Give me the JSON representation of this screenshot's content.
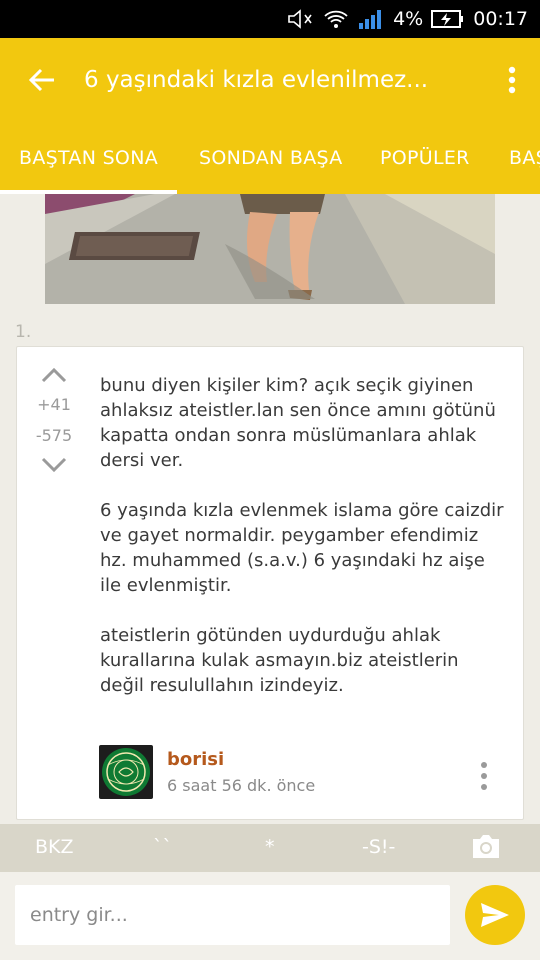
{
  "status_bar": {
    "battery": "4%",
    "time": "00:17"
  },
  "appbar": {
    "title": "6 yaşındaki kızla evlenilmez..."
  },
  "tabs": [
    {
      "label": "BAŞTAN SONA",
      "active": true
    },
    {
      "label": "SONDAN BAŞA",
      "active": false
    },
    {
      "label": "POPÜLER",
      "active": false
    },
    {
      "label": "BAŞ",
      "active": false
    }
  ],
  "entry": {
    "index": "1.",
    "upvotes": "+41",
    "downvotes": "-575",
    "paragraphs": [
      "bunu diyen kişiler kim? açık seçik giyinen ahlaksız ateistler.lan sen önce amını götünü kapatta ondan sonra müslümanlara ahlak dersi ver.",
      "6 yaşında kızla evlenmek islama göre caizdir ve gayet normaldir. peygamber efendimiz hz. muhammed (s.a.v.) 6 yaşındaki hz aişe ile evlenmiştir.",
      "ateistlerin götünden uydurduğu ahlak kurallarına kulak asmayın.biz ateistlerin değil resulullahın izindeyiz."
    ],
    "author": "borisi",
    "time": "6 saat 56 dk. önce"
  },
  "toolbar": {
    "bkz": "BKZ",
    "backtick": "``",
    "star": "*",
    "spoiler": "-S!-"
  },
  "input": {
    "placeholder": "entry gir..."
  },
  "colors": {
    "accent": "#f2c80f",
    "author": "#b5591c",
    "background": "#efede6"
  }
}
